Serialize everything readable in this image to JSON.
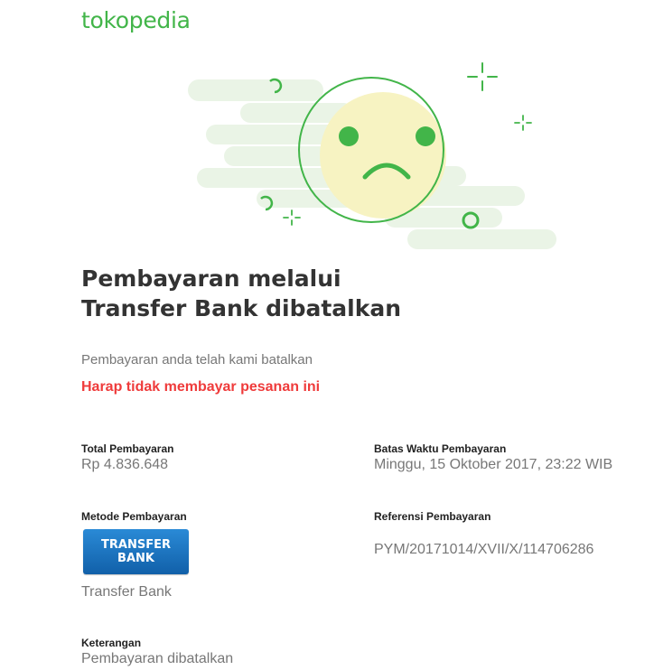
{
  "brand": {
    "logo_text": "tokopedia",
    "accent": "#42b549"
  },
  "hero": {
    "illustration": "sad-face-icon"
  },
  "heading": {
    "line1": "Pembayaran melalui",
    "line2": "Transfer Bank dibatalkan"
  },
  "message": {
    "subtitle": "Pembayaran anda telah kami batalkan",
    "warning": "Harap tidak membayar pesanan ini",
    "warning_color": "#ef3b3b"
  },
  "details": {
    "total": {
      "label": "Total Pembayaran",
      "value": "Rp 4.836.648"
    },
    "deadline": {
      "label": "Batas Waktu Pembayaran",
      "value": "Minggu, 15 Oktober 2017, 23:22 WIB"
    },
    "method": {
      "label": "Metode Pembayaran",
      "badge_line1": "TRANSFER",
      "badge_line2": "BANK",
      "caption": "Transfer Bank",
      "badge_color": "#1a6fc0"
    },
    "reference": {
      "label": "Referensi Pembayaran",
      "value": "PYM/20171014/XVII/X/114706286"
    },
    "note": {
      "label": "Keterangan",
      "value": "Pembayaran dibatalkan"
    }
  }
}
